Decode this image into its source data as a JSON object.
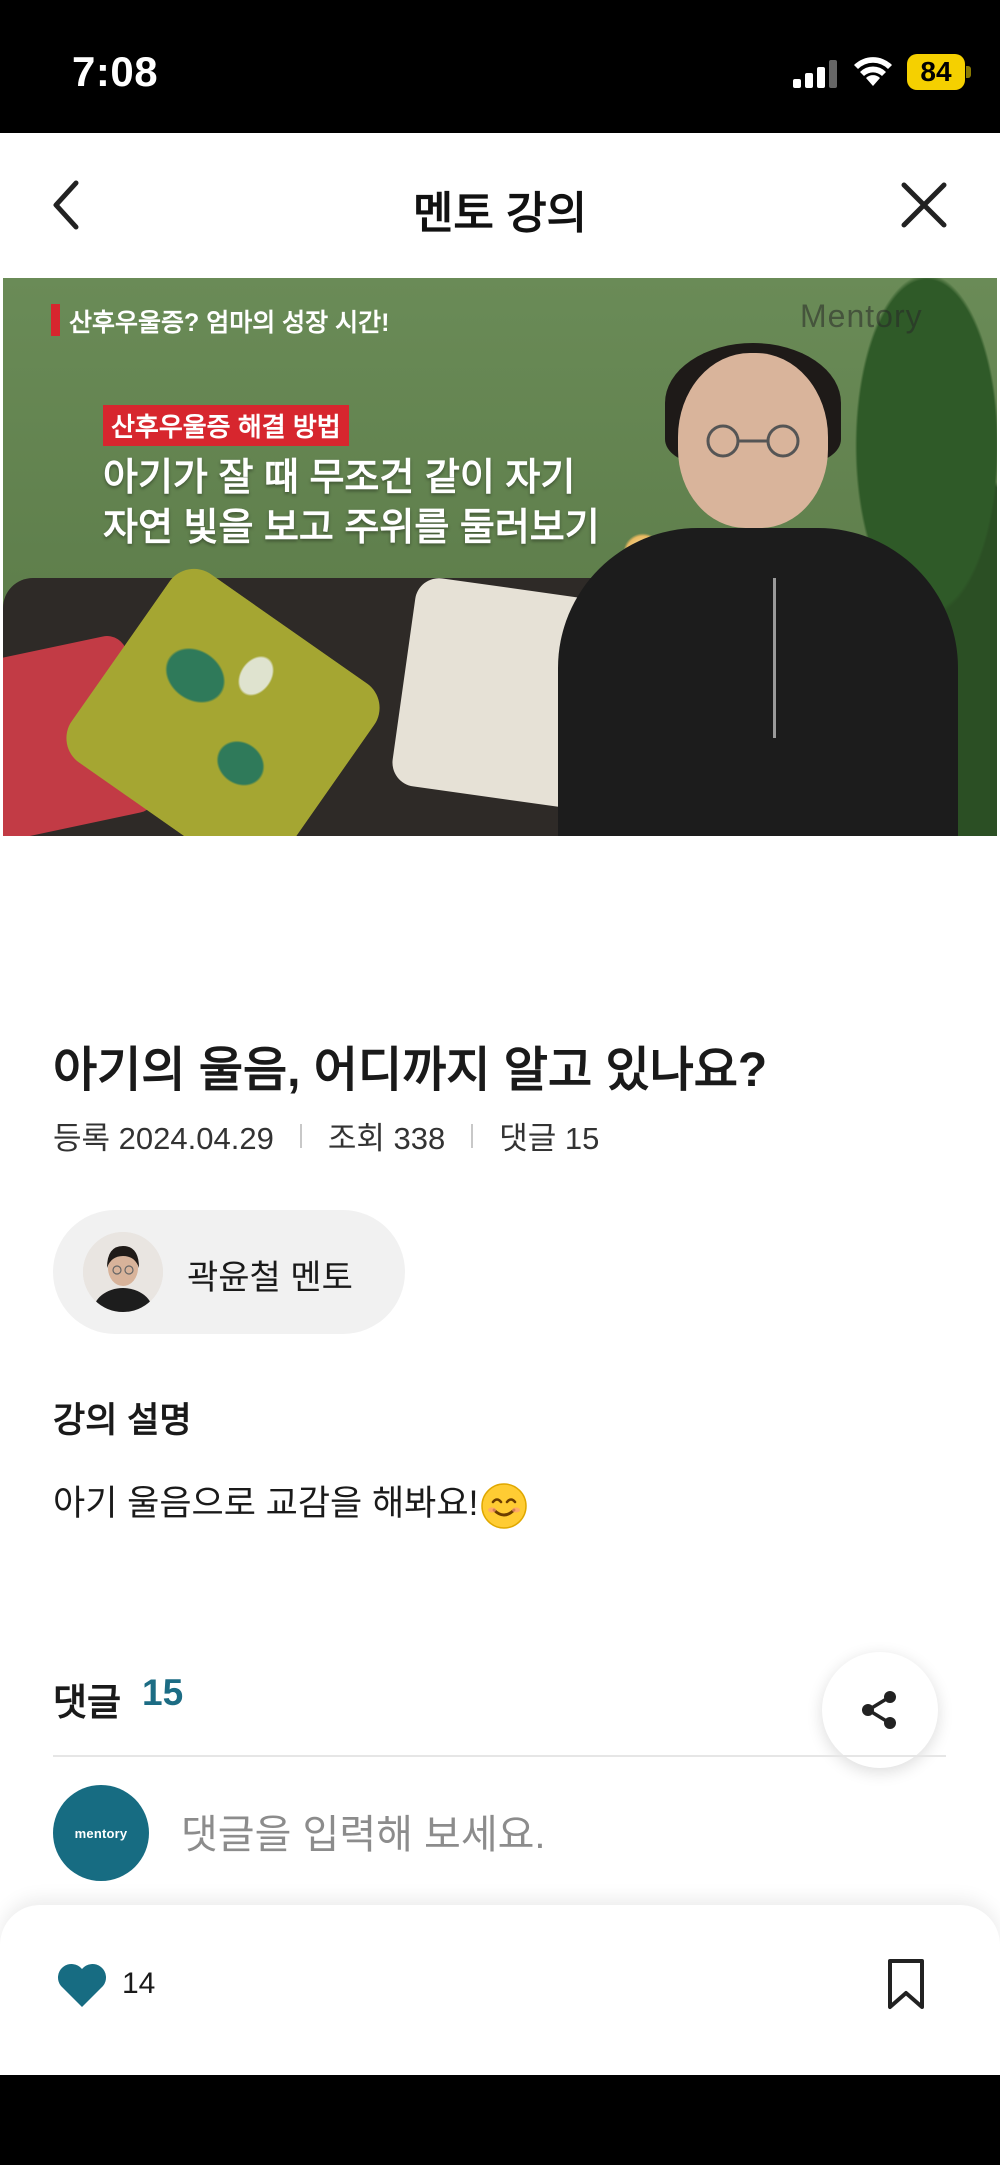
{
  "status_bar": {
    "time": "7:08",
    "battery": "84"
  },
  "nav": {
    "title": "멘토 강의"
  },
  "video": {
    "tag": "산후우울증? 엄마의 성장 시간!",
    "watermark": "Mentory",
    "headline_tag": "산후우울증 해결 방법",
    "headline_line1": "아기가 잘 때 무조건 같이 자기",
    "headline_line2": "자연 빛을 보고 주위를 둘러보기"
  },
  "lecture": {
    "title": "아기의 울음, 어디까지 알고 있나요?",
    "registered": "등록 2024.04.29",
    "views": "조회 338",
    "comments_meta": "댓글 15"
  },
  "mentor": {
    "name": "곽윤철 멘토"
  },
  "description": {
    "heading": "강의 설명",
    "text": "아기 울음으로 교감을 해봐요!"
  },
  "comments": {
    "label": "댓글",
    "count": "15",
    "avatar_text": "mentory",
    "placeholder": "댓글을 입력해 보세요."
  },
  "actions": {
    "like_count": "14"
  },
  "colors": {
    "accent": "#176c82",
    "status_badge": "#f5d000",
    "headline_red": "#d7262e"
  },
  "icons": {
    "back": "chevron-left-icon",
    "close": "close-icon",
    "share": "share-icon",
    "like": "heart-icon",
    "bookmark": "bookmark-icon"
  }
}
